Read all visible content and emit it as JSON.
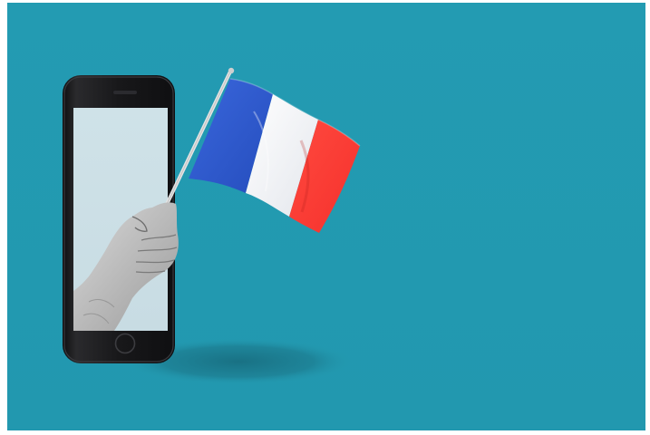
{
  "image": {
    "kind": "photo-illustration",
    "subject": "hand-emerging-from-smartphone-holding-flag",
    "flag": "France",
    "colors": {
      "background": "#239bb2",
      "phone_body": "#1b1b1d",
      "screen": "#cfe1e7",
      "flag_blue": "#2f5bd0",
      "flag_white": "#f3f4f6",
      "flag_red": "#ff3b34",
      "shadow": "#1b6d7f"
    }
  }
}
